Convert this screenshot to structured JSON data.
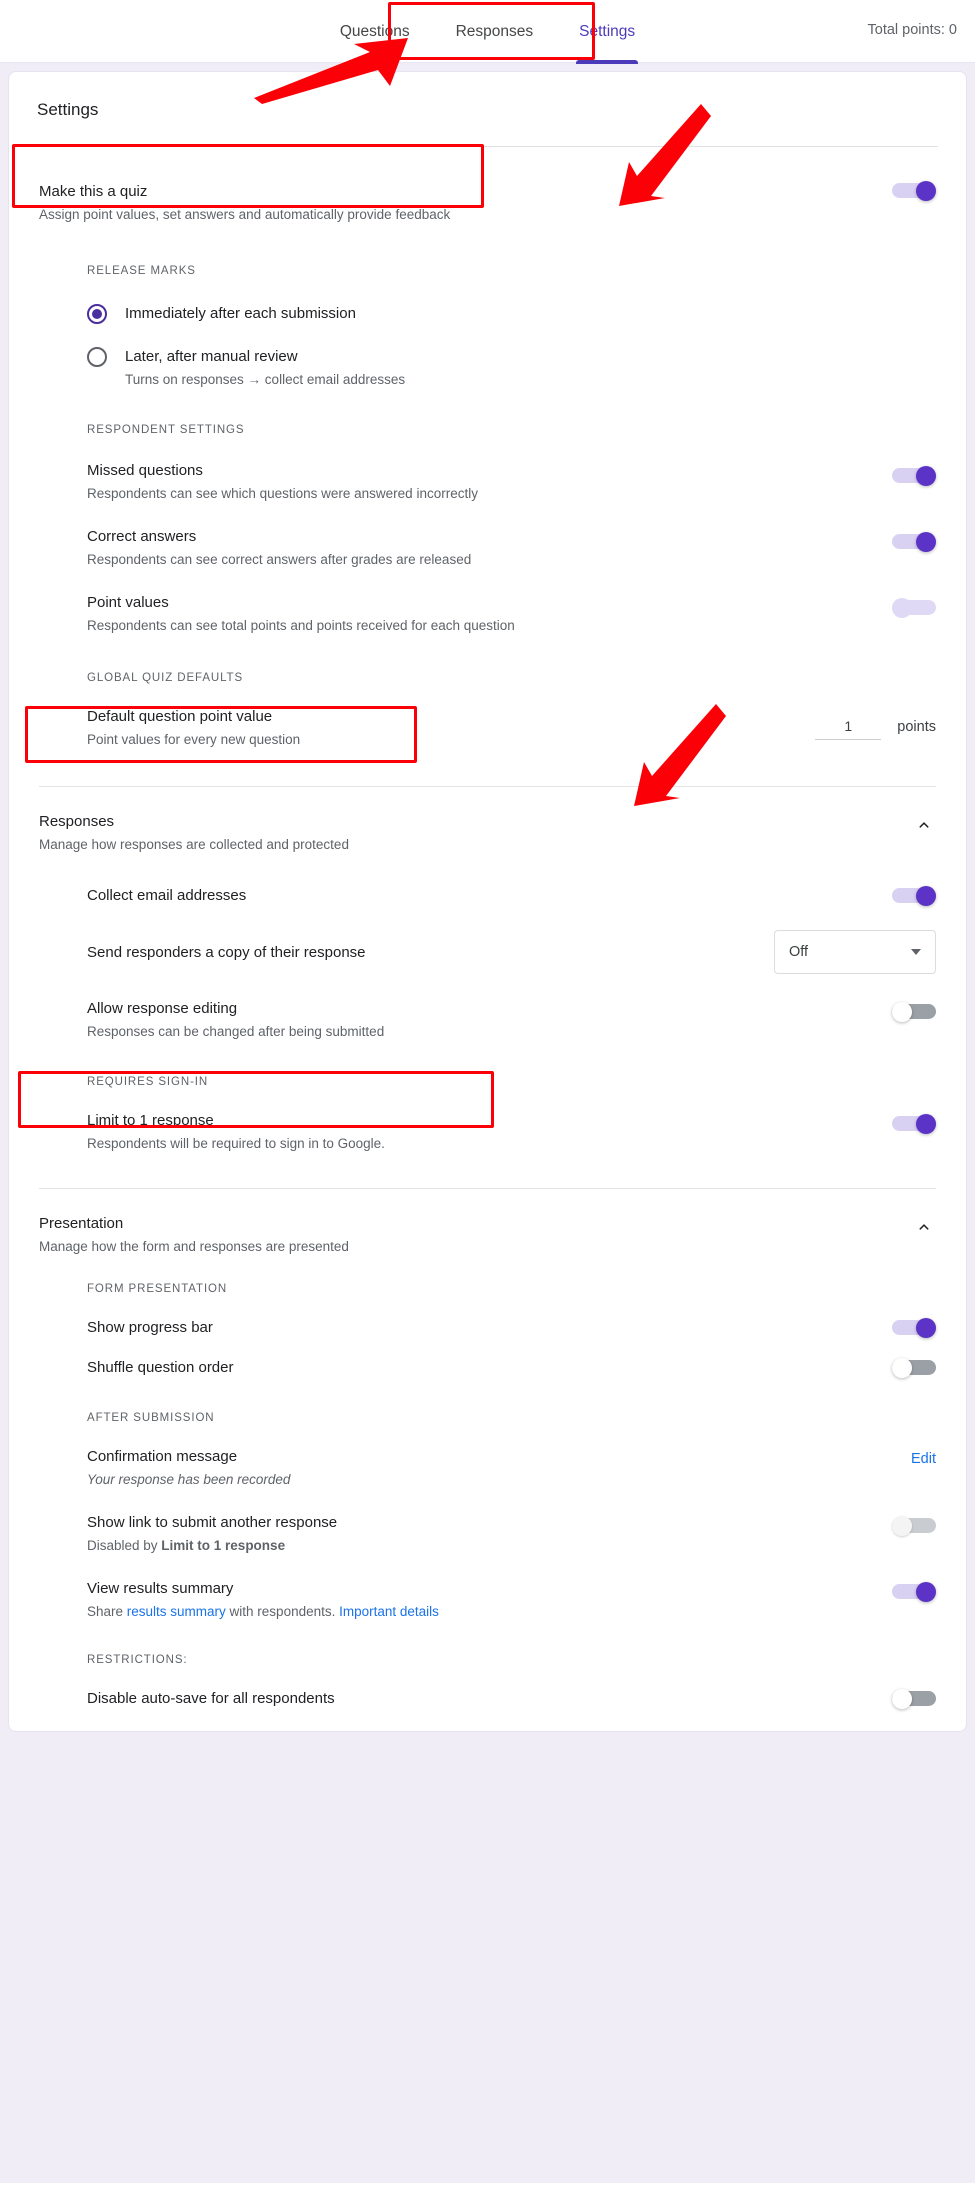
{
  "header": {
    "tabs": [
      {
        "label": "Questions",
        "active": false
      },
      {
        "label": "Responses",
        "active": false
      },
      {
        "label": "Settings",
        "active": true
      }
    ],
    "total_points": "Total points: 0"
  },
  "page": {
    "title": "Settings"
  },
  "quiz": {
    "label": "Make this a quiz",
    "sub": "Assign point values, set answers and automatically provide feedback",
    "toggle_state": "on",
    "release_marks": {
      "heading": "Release marks",
      "options": [
        {
          "label": "Immediately after each submission",
          "sub": "",
          "selected": true
        },
        {
          "label": "Later, after manual review",
          "sub": "Turns on responses → collect email addresses",
          "selected": false
        }
      ]
    },
    "respondent_settings": {
      "heading": "Respondent settings",
      "items": [
        {
          "label": "Missed questions",
          "sub": "Respondents can see which questions were answered incorrectly",
          "toggle_state": "on"
        },
        {
          "label": "Correct answers",
          "sub": "Respondents can see correct answers after grades are released",
          "toggle_state": "on"
        },
        {
          "label": "Point values",
          "sub": "Respondents can see total points and points received for each question",
          "toggle_state": "dim"
        }
      ]
    },
    "global_defaults": {
      "heading": "Global quiz defaults",
      "label": "Default question point value",
      "sub": "Point values for every new question",
      "value": "1",
      "unit": "points"
    }
  },
  "responses": {
    "label": "Responses",
    "sub": "Manage how responses are collected and protected",
    "chevron": "chevron-up-icon",
    "collect_email": {
      "label": "Collect email addresses",
      "toggle_state": "on"
    },
    "send_copy": {
      "label": "Send responders a copy of their response",
      "value": "Off"
    },
    "allow_editing": {
      "label": "Allow response editing",
      "sub": "Responses can be changed after being submitted",
      "toggle_state": "off"
    },
    "requires_signin_heading": "Requires sign-in",
    "limit_one": {
      "label": "Limit to 1 response",
      "sub": "Respondents will be required to sign in to Google.",
      "toggle_state": "on"
    }
  },
  "presentation": {
    "label": "Presentation",
    "sub": "Manage how the form and responses are presented",
    "chevron": "chevron-up-icon",
    "form_presentation_heading": "Form presentation",
    "progress_bar": {
      "label": "Show progress bar",
      "toggle_state": "on"
    },
    "shuffle": {
      "label": "Shuffle question order",
      "toggle_state": "off"
    },
    "after_submission_heading": "After submission",
    "confirmation": {
      "label": "Confirmation message",
      "sub": "Your response has been recorded",
      "action": "Edit"
    },
    "show_link": {
      "label": "Show link to submit another response",
      "sub_prefix": "Disabled by ",
      "sub_bold": "Limit to 1 response",
      "toggle_state": "offdim"
    },
    "results_summary": {
      "label": "View results summary",
      "sub_1": "Share ",
      "sub_link_1": "results summary",
      "sub_2": " with respondents. ",
      "sub_link_2": "Important details",
      "toggle_state": "on"
    },
    "restrictions_heading": "Restrictions:",
    "autosave": {
      "label": "Disable auto-save for all respondents",
      "toggle_state": "off"
    }
  },
  "colors": {
    "accent_purple": "#5b34c7",
    "annotation_red": "#fb0007",
    "link_blue": "#1a73e8",
    "page_bg": "#f0edf6"
  }
}
